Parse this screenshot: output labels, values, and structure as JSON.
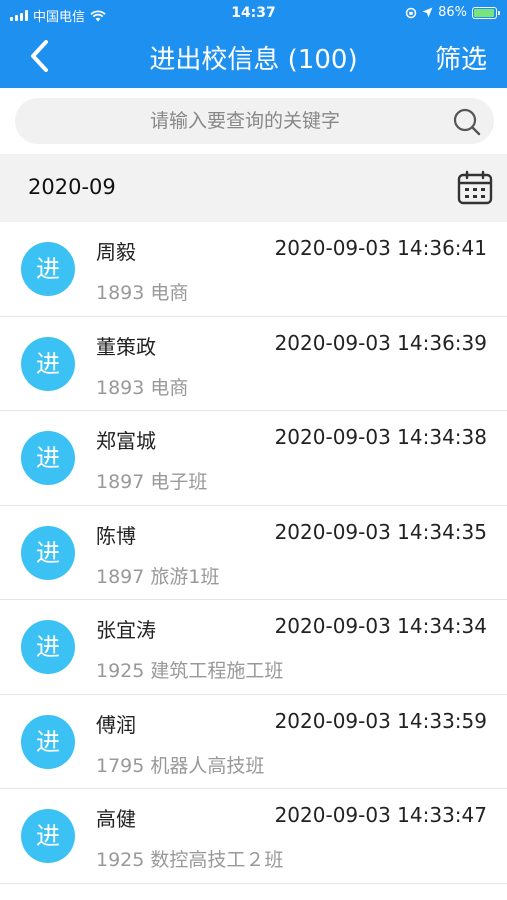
{
  "status_bar": {
    "carrier": "中国电信",
    "time": "14:37",
    "battery": "86%",
    "battery_level": 0.86
  },
  "nav": {
    "back_icon": "chevron-left-icon",
    "title": "进出校信息 (100)",
    "filter_label": "筛选"
  },
  "search": {
    "placeholder": "请输入要查询的关键字",
    "value": ""
  },
  "month_header": {
    "month": "2020-09",
    "icon": "calendar-icon"
  },
  "colors": {
    "primary": "#1e90f0",
    "badge": "#3cc1f5"
  },
  "records": [
    {
      "badge": "进",
      "name": "周毅",
      "dept": "1893 电商",
      "time": "2020-09-03 14:36:41"
    },
    {
      "badge": "进",
      "name": "董策政",
      "dept": "1893 电商",
      "time": "2020-09-03 14:36:39"
    },
    {
      "badge": "进",
      "name": "郑富城",
      "dept": "1897 电子班",
      "time": "2020-09-03 14:34:38"
    },
    {
      "badge": "进",
      "name": "陈博",
      "dept": "1897 旅游1班",
      "time": "2020-09-03 14:34:35"
    },
    {
      "badge": "进",
      "name": "张宜涛",
      "dept": "1925 建筑工程施工班",
      "time": "2020-09-03 14:34:34"
    },
    {
      "badge": "进",
      "name": "傅润",
      "dept": "1795 机器人高技班",
      "time": "2020-09-03 14:33:59"
    },
    {
      "badge": "进",
      "name": "高健",
      "dept": "1925 数控高技工２班",
      "time": "2020-09-03 14:33:47"
    }
  ]
}
